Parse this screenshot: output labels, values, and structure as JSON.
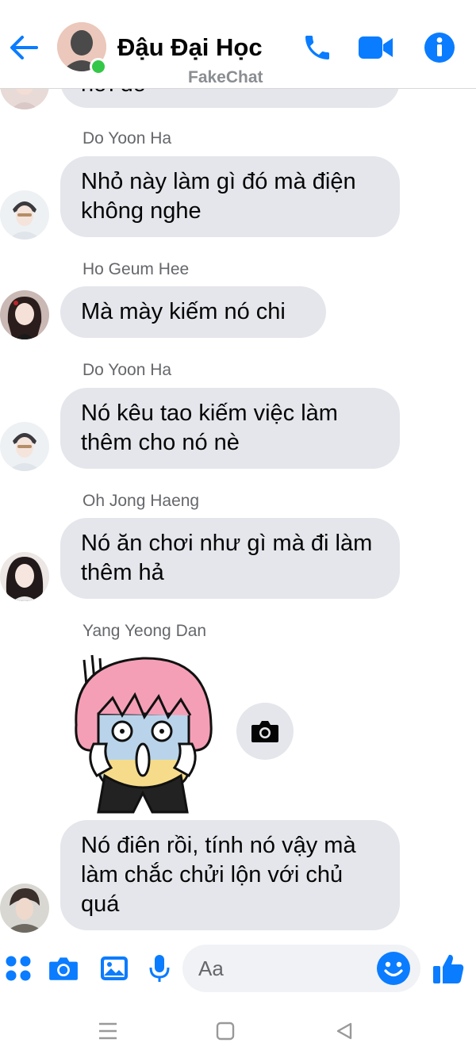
{
  "header": {
    "title": "Đậu Đại Học",
    "subtitle": "FakeChat",
    "back_icon": "arrow-left-icon",
    "call_icon": "phone-icon",
    "video_icon": "video-icon",
    "info_icon": "info-icon",
    "accent_color": "#0a7cff",
    "online_color": "#35c747"
  },
  "messages": [
    {
      "sender": "",
      "text": "hơi dở"
    },
    {
      "sender": "Do Yoon Ha",
      "text": "Nhỏ này làm gì đó mà điện không nghe"
    },
    {
      "sender": "Ho Geum Hee",
      "text": "Mà mày kiếm nó chi"
    },
    {
      "sender": "Do Yoon Ha",
      "text": "Nó kêu tao kiếm việc làm thêm cho nó nè"
    },
    {
      "sender": "Oh Jong Haeng",
      "text": "Nó ăn chơi như gì mà đi làm thêm hả"
    },
    {
      "sender": "Yang Yeong Dan",
      "text": ""
    },
    {
      "sender": "",
      "text": "Nó điên rồi, tính nó vậy mà làm chắc chửi lộn với chủ quá"
    }
  ],
  "composer": {
    "placeholder": "Aa",
    "icons": [
      "apps-icon",
      "camera-icon",
      "image-icon",
      "mic-icon",
      "emoji-icon",
      "like-icon"
    ]
  },
  "navbar": {
    "icons": [
      "menu-icon",
      "home-icon",
      "back-triangle-icon"
    ]
  }
}
